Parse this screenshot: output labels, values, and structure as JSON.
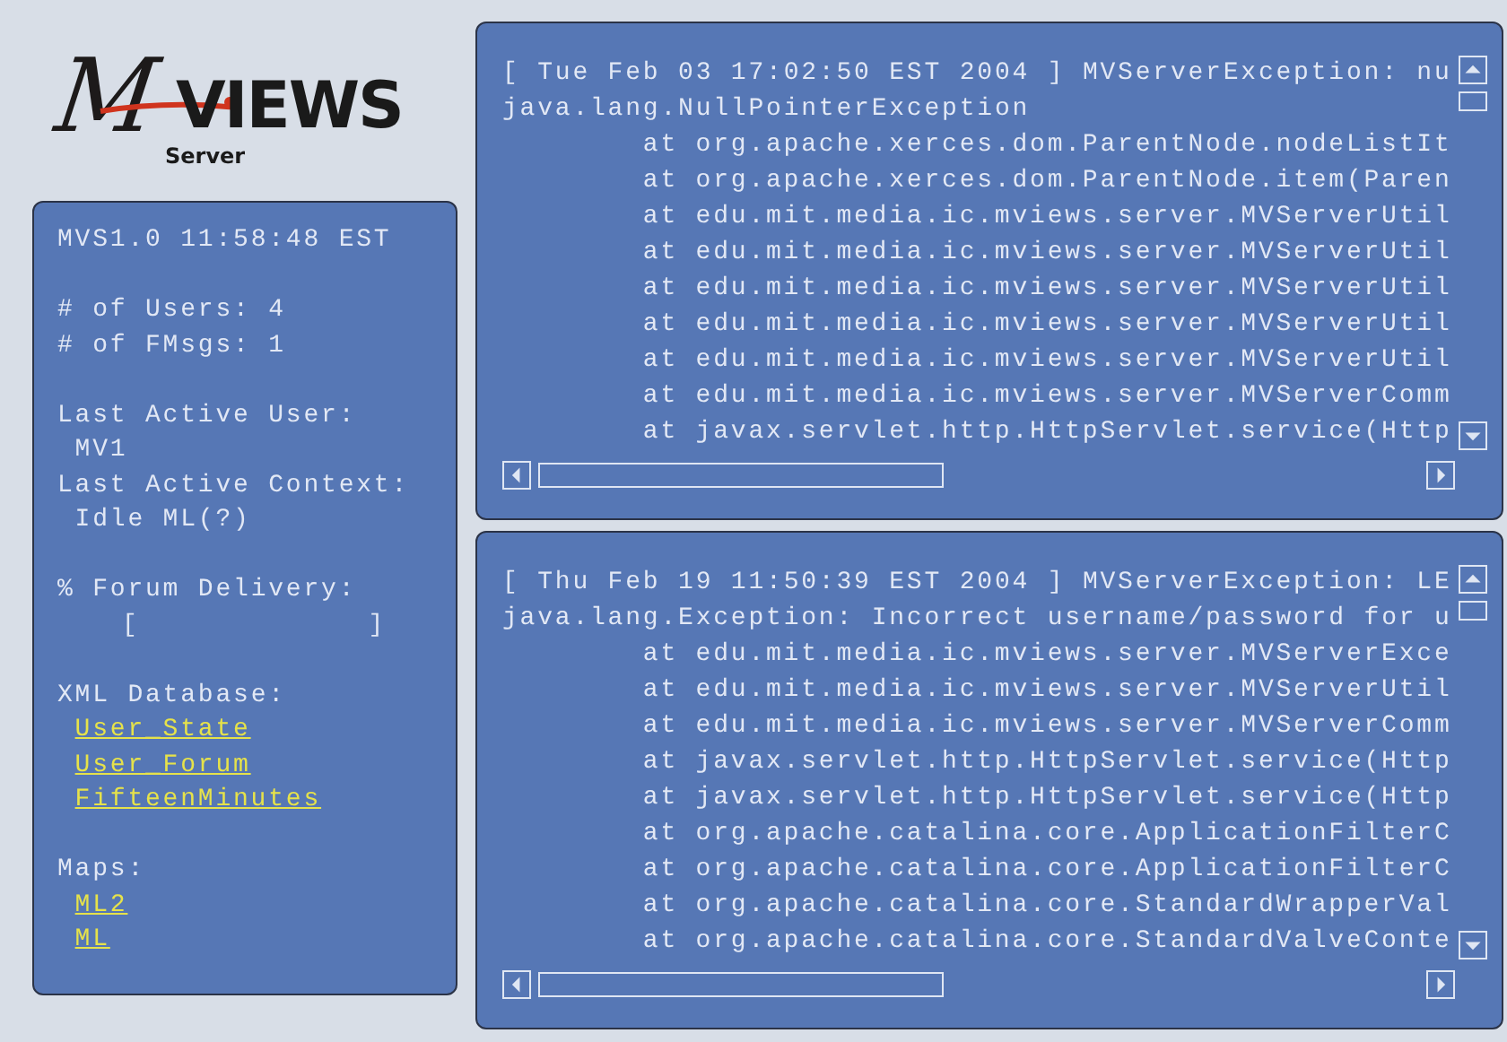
{
  "logo": {
    "mark": "M",
    "name": "VIEWS",
    "subtitle": "Server"
  },
  "status": {
    "sections": [
      {
        "items": [
          {
            "kind": "text",
            "text": "MVS1.0 11:58:48 EST"
          }
        ]
      },
      {
        "items": [
          {
            "kind": "text",
            "text": "# of Users: 4"
          },
          {
            "kind": "text",
            "text": "# of FMsgs: 1"
          }
        ]
      },
      {
        "items": [
          {
            "kind": "text",
            "text": "Last Active User:"
          },
          {
            "kind": "value",
            "text": "MV1"
          },
          {
            "kind": "text",
            "text": "Last Active Context:"
          },
          {
            "kind": "value",
            "text": "Idle ML(?)"
          }
        ]
      },
      {
        "items": [
          {
            "kind": "text",
            "text": "% Forum Delivery:"
          },
          {
            "kind": "meter",
            "text": "[             ]"
          }
        ]
      },
      {
        "items": [
          {
            "kind": "text",
            "text": "XML Database:"
          },
          {
            "kind": "link",
            "text": "User_State"
          },
          {
            "kind": "link",
            "text": "User_Forum"
          },
          {
            "kind": "link",
            "text": "FifteenMinutes"
          }
        ]
      },
      {
        "items": [
          {
            "kind": "text",
            "text": "Maps:"
          },
          {
            "kind": "link",
            "text": "ML2"
          },
          {
            "kind": "link",
            "text": "ML"
          }
        ]
      }
    ]
  },
  "logs": [
    {
      "header": "[ Tue Feb 03 17:02:50 EST 2004 ] MVServerException: nu",
      "exception": "java.lang.NullPointerException",
      "stack": [
        "at org.apache.xerces.dom.ParentNode.nodeListIt",
        "at org.apache.xerces.dom.ParentNode.item(Paren",
        "at edu.mit.media.ic.mviews.server.MVServerUtil",
        "at edu.mit.media.ic.mviews.server.MVServerUtil",
        "at edu.mit.media.ic.mviews.server.MVServerUtil",
        "at edu.mit.media.ic.mviews.server.MVServerUtil",
        "at edu.mit.media.ic.mviews.server.MVServerUtil",
        "at edu.mit.media.ic.mviews.server.MVServerComm",
        "at javax.servlet.http.HttpServlet.service(Http"
      ]
    },
    {
      "header": "[ Thu Feb 19 11:50:39 EST 2004 ] MVServerException: LE",
      "exception": "java.lang.Exception: Incorrect username/password for u",
      "stack": [
        "at edu.mit.media.ic.mviews.server.MVServerExce",
        "at edu.mit.media.ic.mviews.server.MVServerUtil",
        "at edu.mit.media.ic.mviews.server.MVServerComm",
        "at javax.servlet.http.HttpServlet.service(Http",
        "at javax.servlet.http.HttpServlet.service(Http",
        "at org.apache.catalina.core.ApplicationFilterC",
        "at org.apache.catalina.core.ApplicationFilterC",
        "at org.apache.catalina.core.StandardWrapperVal",
        "at org.apache.catalina.core.StandardValveConte"
      ]
    }
  ]
}
